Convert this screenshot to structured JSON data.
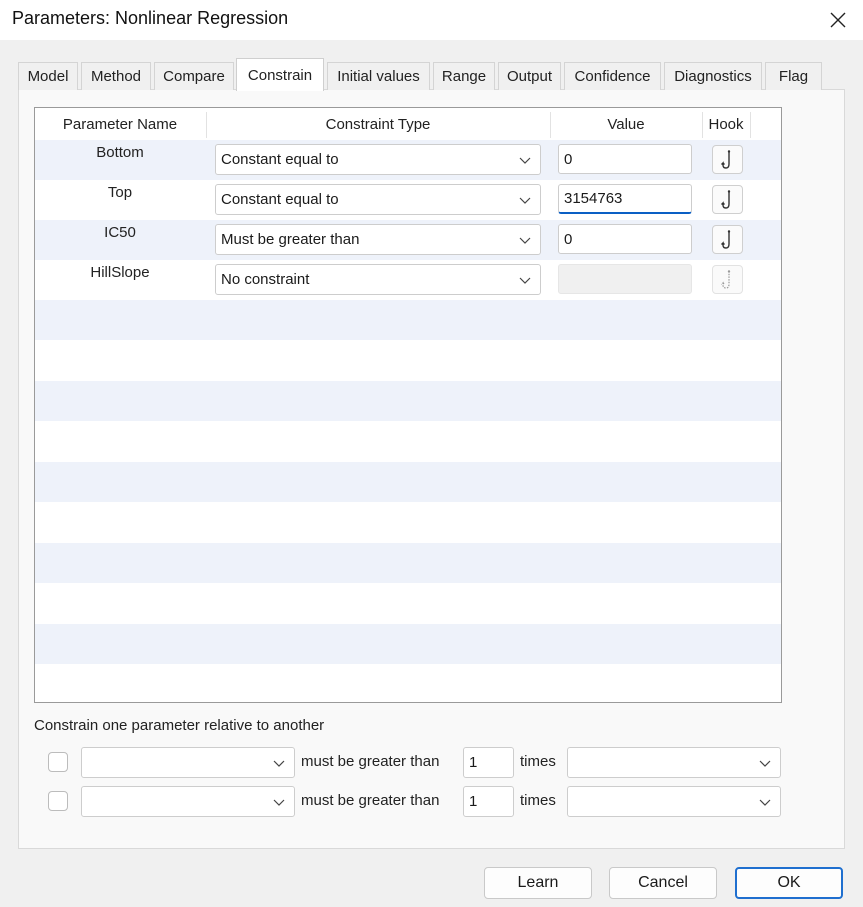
{
  "window": {
    "title": "Parameters: Nonlinear Regression"
  },
  "tabs": [
    {
      "label": "Model"
    },
    {
      "label": "Method"
    },
    {
      "label": "Compare"
    },
    {
      "label": "Constrain",
      "active": true
    },
    {
      "label": "Initial values"
    },
    {
      "label": "Range"
    },
    {
      "label": "Output"
    },
    {
      "label": "Confidence"
    },
    {
      "label": "Diagnostics"
    },
    {
      "label": "Flag"
    }
  ],
  "grid": {
    "headers": {
      "parameter_name": "Parameter Name",
      "constraint_type": "Constraint Type",
      "value": "Value",
      "hook": "Hook"
    },
    "rows": [
      {
        "name": "Bottom",
        "constraint": "Constant equal to",
        "value": "0"
      },
      {
        "name": "Top",
        "constraint": "Constant equal to",
        "value": "3154763"
      },
      {
        "name": "IC50",
        "constraint": "Must be greater than",
        "value": "0"
      },
      {
        "name": "HillSlope",
        "constraint": "No constraint",
        "value": ""
      }
    ]
  },
  "relative": {
    "label": "Constrain one parameter relative to another",
    "rows": [
      {
        "checked": false,
        "left_value": "",
        "relation": "must be greater than",
        "factor": "1",
        "times": "times",
        "right_value": ""
      },
      {
        "checked": false,
        "left_value": "",
        "relation": "must be greater than",
        "factor": "1",
        "times": "times",
        "right_value": ""
      }
    ]
  },
  "buttons": {
    "learn": "Learn",
    "cancel": "Cancel",
    "ok": "OK"
  },
  "colors": {
    "accent": "#1f6fcf",
    "stripe": "#eef2fa",
    "dialog_bg": "#f0f0f0"
  }
}
